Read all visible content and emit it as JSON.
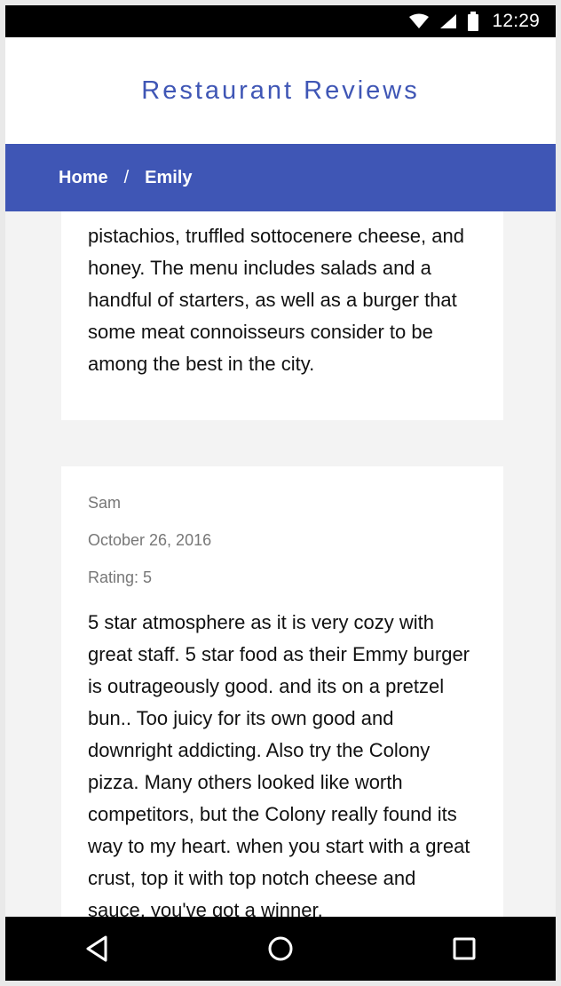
{
  "status_bar": {
    "time": "12:29",
    "icons": [
      "wifi-icon",
      "signal-icon",
      "battery-icon"
    ]
  },
  "app": {
    "title": "Restaurant Reviews",
    "accent_color": "#3f56b5"
  },
  "breadcrumb": {
    "items": [
      "Home",
      "Emily"
    ],
    "separator": "/"
  },
  "reviews": [
    {
      "name": "",
      "date": "",
      "rating": "",
      "text": "pistachios, truffled sottocenere cheese, and honey. The menu includes salads and a handful of starters, as well as a burger that some meat connoisseurs consider to be among the best in the city."
    },
    {
      "name": "Sam",
      "date": "October 26, 2016",
      "rating": "Rating: 5",
      "text": "5 star atmosphere as it is very cozy with great staff. 5 star food as their Emmy burger is outrageously good. and its on a pretzel bun.. Too juicy for its own good and downright addicting. Also try the Colony pizza. Many others looked like worth competitors, but the Colony really found its way to my heart. when you start with a great crust, top it with top notch cheese and sauce, you've got a winner."
    }
  ],
  "nav_bar": {
    "icons": [
      "back-icon",
      "home-icon",
      "recents-icon"
    ]
  }
}
